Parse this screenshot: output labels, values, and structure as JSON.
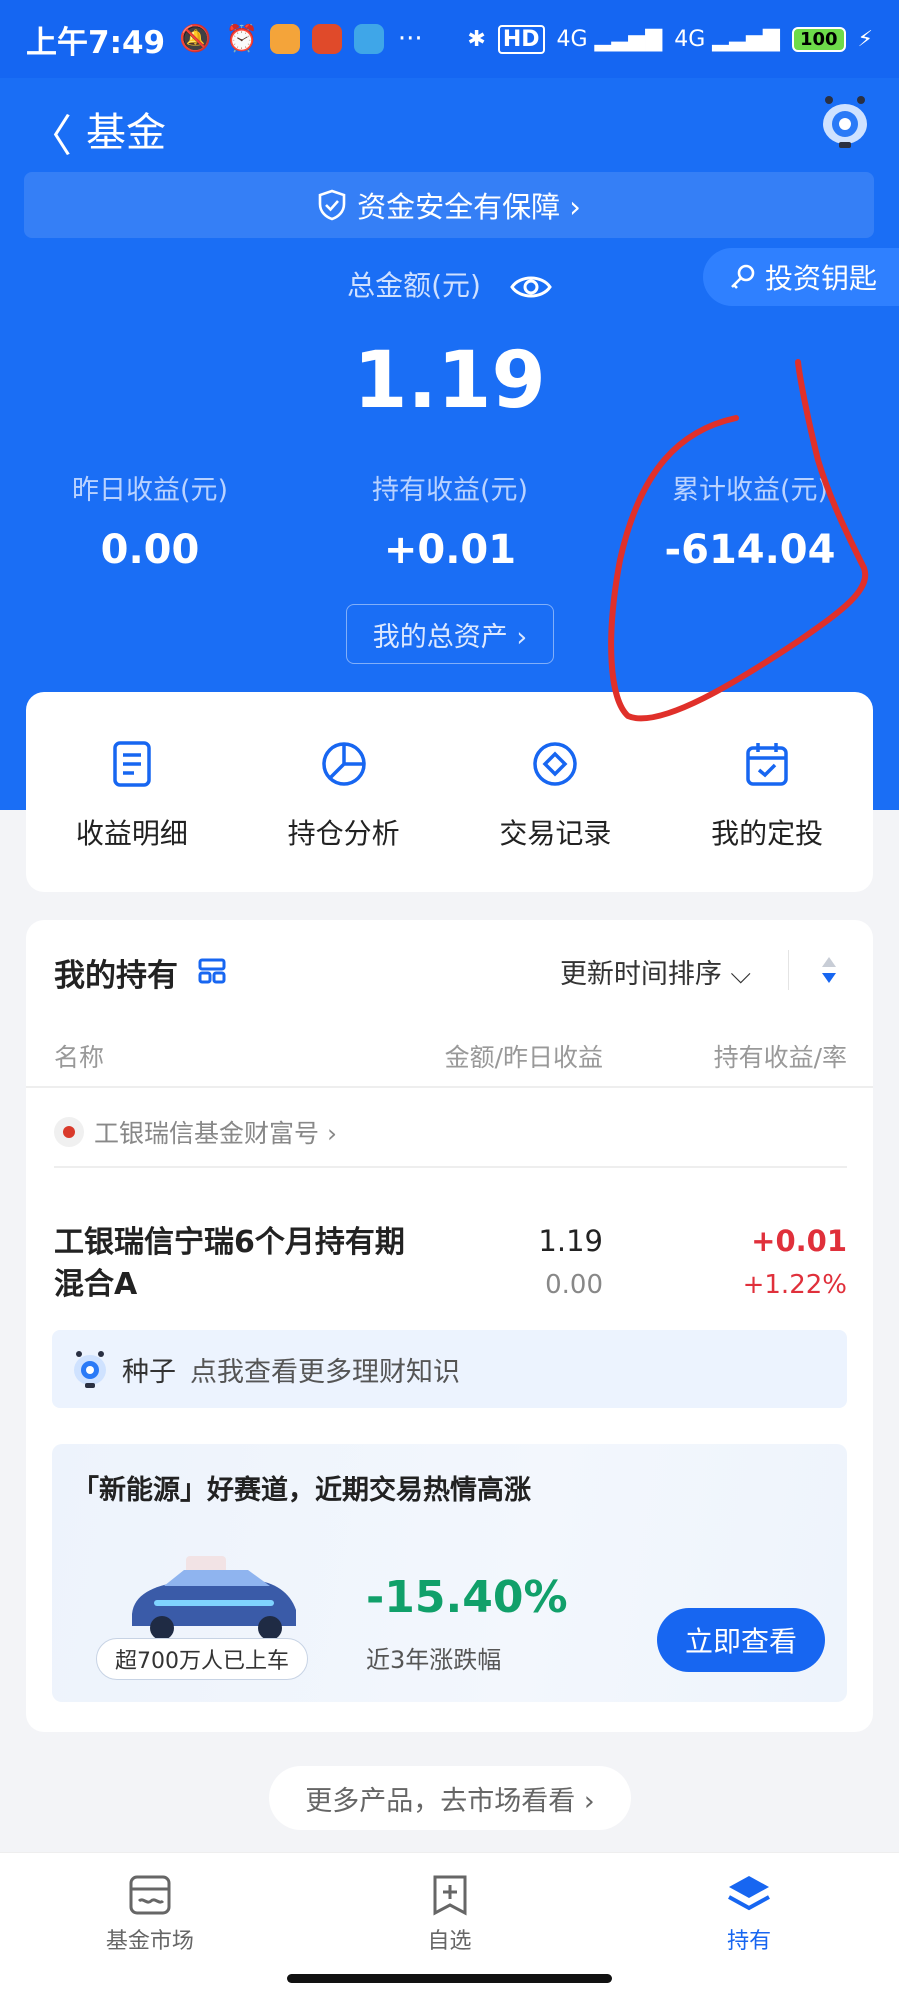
{
  "status_bar": {
    "time": "上午7:49",
    "dots": "···",
    "network_hd": "HD",
    "network_a": "4G",
    "network_b": "4G",
    "battery": "100"
  },
  "header": {
    "title": "基金",
    "safety_text": "资金安全有保障 ›",
    "invest_key": "投资钥匙",
    "total_label": "总金额(元)",
    "total_amount": "1.19",
    "assets_button": "我的总资产 ›"
  },
  "stats": [
    {
      "label": "昨日收益(元)",
      "value": "0.00"
    },
    {
      "label": "持有收益(元)",
      "value": "+0.01"
    },
    {
      "label": "累计收益(元)",
      "value": "-614.04"
    }
  ],
  "quick_actions": [
    {
      "label": "收益明细",
      "icon": "document-icon"
    },
    {
      "label": "持仓分析",
      "icon": "pie-chart-icon"
    },
    {
      "label": "交易记录",
      "icon": "diamond-circle-icon"
    },
    {
      "label": "我的定投",
      "icon": "calendar-check-icon"
    }
  ],
  "holdings": {
    "title": "我的持有",
    "sort_label": "更新时间排序 ⌵",
    "columns": [
      "名称",
      "金额/昨日收益",
      "持有收益/率"
    ],
    "provider": "工银瑞信基金财富号 ›",
    "fund": {
      "name": "工银瑞信宁瑞6个月持有期混合A",
      "amount": "1.19",
      "yesterday": "0.00",
      "hold_profit": "+0.01",
      "hold_rate": "+1.22%"
    },
    "seed": {
      "tag": "种子",
      "text": "点我查看更多理财知识"
    },
    "promo": {
      "title": "「新能源」好赛道，近期交易热情高涨",
      "badge": "超700万人已上车",
      "percent": "-15.40%",
      "percent_label": "近3年涨跌幅",
      "button": "立即查看"
    }
  },
  "more_market": "更多产品，去市场看看 ›",
  "tabs": [
    {
      "label": "基金市场",
      "icon": "market-icon",
      "active": false
    },
    {
      "label": "自选",
      "icon": "add-bookmark-icon",
      "active": false
    },
    {
      "label": "持有",
      "icon": "layers-icon",
      "active": true
    }
  ],
  "colors": {
    "brand_blue": "#1a6ef5",
    "profit_red": "#e0303b",
    "loss_green": "#11a06a",
    "annotation_red": "#e0302a"
  }
}
